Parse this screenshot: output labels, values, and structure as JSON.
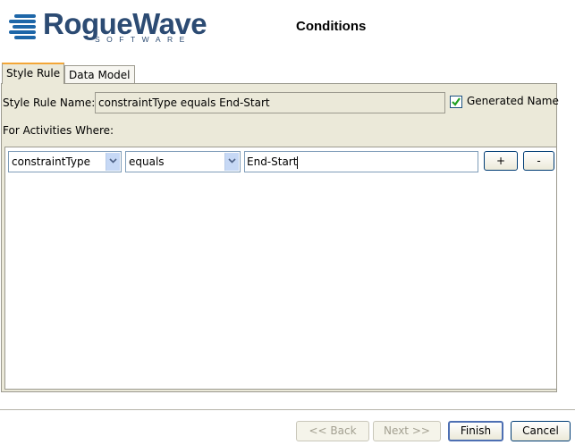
{
  "header": {
    "logo_text": "RogueWave",
    "logo_subtext": "SOFTWARE",
    "title": "Conditions"
  },
  "tabs": [
    {
      "label": "Style Rule",
      "active": true
    },
    {
      "label": "Data Model",
      "active": false
    }
  ],
  "style_rule": {
    "name_label": "Style Rule Name:",
    "name_value": "constraintType equals End-Start",
    "generated_name_label": "Generated Name",
    "generated_name_checked": true,
    "activities_label": "For Activities Where:"
  },
  "condition": {
    "attribute": "constraintType",
    "operator": "equals",
    "value": "End-Start",
    "add_label": "+",
    "remove_label": "-"
  },
  "footer": {
    "back_label": "<< Back",
    "next_label": "Next >>",
    "finish_label": "Finish",
    "cancel_label": "Cancel"
  },
  "colors": {
    "panel_bg": "#ebe9d9",
    "logo_blue": "#2c4b73",
    "tab_accent": "#f3a637"
  }
}
